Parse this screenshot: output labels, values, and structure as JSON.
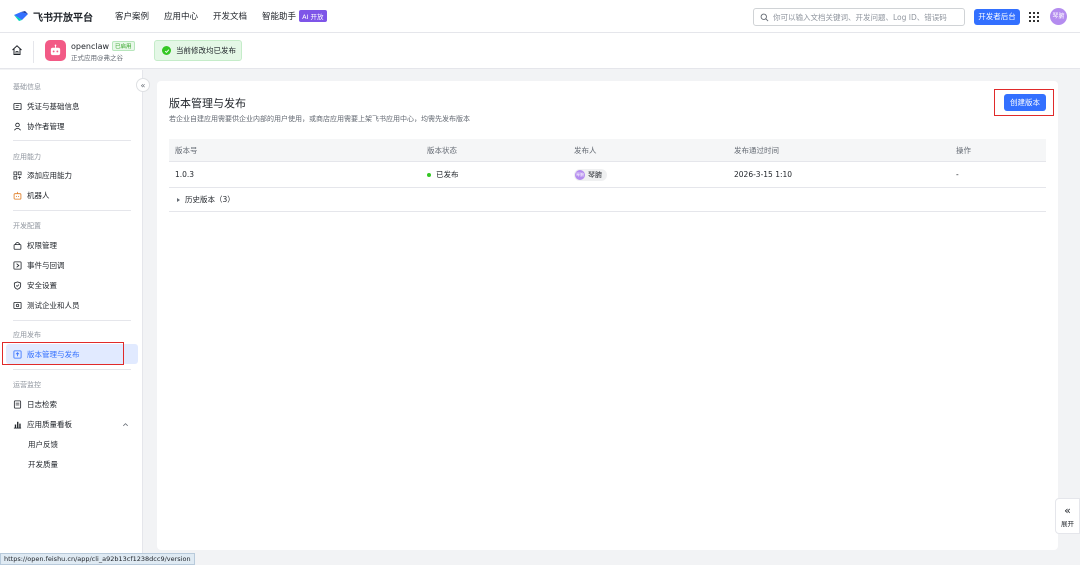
{
  "topbar": {
    "brand": "飞书开放平台",
    "nav": [
      "客户案例",
      "应用中心",
      "开发文档",
      "智能助手"
    ],
    "ai_badge": "AI 开放",
    "search_placeholder": "你可以输入文档关键词、开发问题、Log ID、错误码",
    "dev_console": "开发者后台",
    "avatar_text": "琴腑"
  },
  "app": {
    "name": "openclaw",
    "status_badge": "已启用",
    "subtitle": "正式应用@弗之谷",
    "release_status": "当前修改均已发布"
  },
  "sidebar": {
    "sections": [
      {
        "title": "基础信息",
        "items": [
          {
            "label": "凭证与基础信息",
            "icon": "credential-icon"
          },
          {
            "label": "协作者管理",
            "icon": "user-icon"
          }
        ]
      },
      {
        "title": "应用能力",
        "items": [
          {
            "label": "添加应用能力",
            "icon": "grid-add-icon"
          },
          {
            "label": "机器人",
            "icon": "robot-icon"
          }
        ]
      },
      {
        "title": "开发配置",
        "items": [
          {
            "label": "权限管理",
            "icon": "permission-icon"
          },
          {
            "label": "事件与回调",
            "icon": "event-icon"
          },
          {
            "label": "安全设置",
            "icon": "shield-icon"
          },
          {
            "label": "测试企业和人员",
            "icon": "test-icon"
          }
        ]
      },
      {
        "title": "应用发布",
        "items": [
          {
            "label": "版本管理与发布",
            "icon": "version-icon"
          }
        ]
      },
      {
        "title": "运营监控",
        "items": [
          {
            "label": "日志检索",
            "icon": "log-icon"
          },
          {
            "label": "应用质量看板",
            "icon": "chart-icon"
          },
          {
            "label": "用户反馈"
          },
          {
            "label": "开发质量"
          }
        ]
      }
    ]
  },
  "main": {
    "title": "版本管理与发布",
    "description": "若企业自建应用需要供企业内部的用户使用，或商店应用需要上架飞书应用中心，均需先发布版本",
    "create_button": "创建版本",
    "table": {
      "headers": [
        "版本号",
        "版本状态",
        "发布人",
        "发布通过时间",
        "操作"
      ],
      "rows": [
        {
          "version": "1.0.3",
          "status": "已发布",
          "publisher": "琴腑",
          "publisher_avatar": "琴腑",
          "time": "2026-3-15 1:10",
          "action": "-"
        }
      ],
      "history_label": "历史版本（3）"
    }
  },
  "float_panel": {
    "label": "展开"
  },
  "status_url": "https://open.feishu.cn/app/cli_a92b13cf1238dcc9/version",
  "colors": {
    "accent": "#3370ff",
    "success": "#34c724",
    "highlight_box": "#e02a2a",
    "app_icon": "#f25a86"
  }
}
